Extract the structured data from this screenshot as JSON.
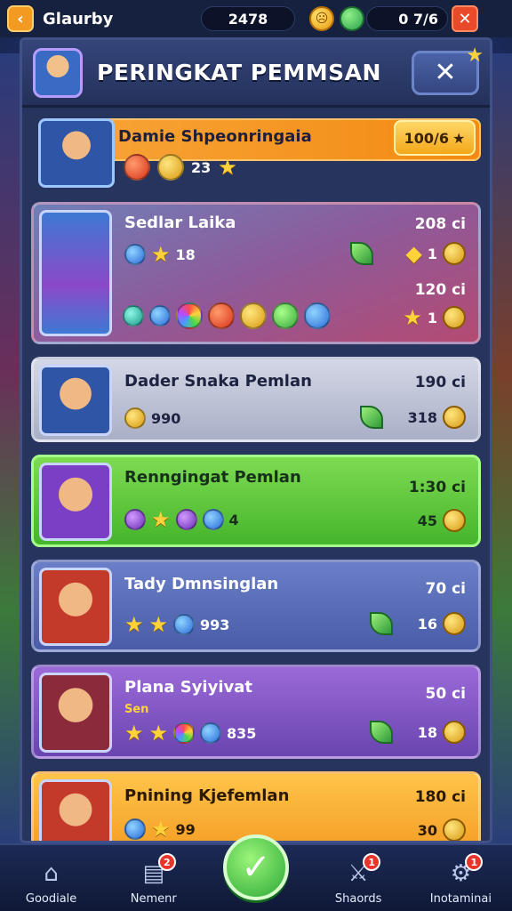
{
  "topbar": {
    "back_icon": "chevron-left-icon",
    "title": "Glaurby",
    "center_value": "2478",
    "right_value": "0 7/6",
    "close_icon": "close-icon"
  },
  "header": {
    "title": "PERINGKAT PEMMSAN",
    "close_icon": "close-icon"
  },
  "featured": {
    "name": "Damie Shpeonringaia",
    "score": "100/6",
    "count": "23"
  },
  "rows": [
    {
      "name": "Sedlar Laika",
      "score_top": "208 ci",
      "count": "18",
      "val_a": "1",
      "score_bottom": "120 ci",
      "val_b": "1"
    },
    {
      "name": "Dader Snaka Pemlan",
      "score_top": "190 ci",
      "count": "990",
      "val_a": "318"
    },
    {
      "name": "Renngingat Pemlan",
      "score_top": "1:30 ci",
      "count": "4",
      "val_a": "45"
    },
    {
      "name": "Tady Dmnsinglan",
      "score_top": "70 ci",
      "count": "993",
      "val_a": "16"
    },
    {
      "name": "Plana Syiyivat",
      "subtitle": "Sen",
      "score_top": "50 ci",
      "count": "835",
      "val_a": "18"
    },
    {
      "name": "Pnining Kjefemlan",
      "score_top": "180 ci",
      "count": "99",
      "val_a": "30"
    }
  ],
  "nav": [
    {
      "label": "Goodiale",
      "icon": "home-icon",
      "badge": ""
    },
    {
      "label": "Nemenr",
      "icon": "chart-icon",
      "badge": "2"
    },
    {
      "label": "confirm",
      "icon": "check-icon",
      "badge": ""
    },
    {
      "label": "Shaords",
      "icon": "sword-icon",
      "badge": "1"
    },
    {
      "label": "Inotaminai",
      "icon": "gear-icon",
      "badge": "1"
    }
  ]
}
